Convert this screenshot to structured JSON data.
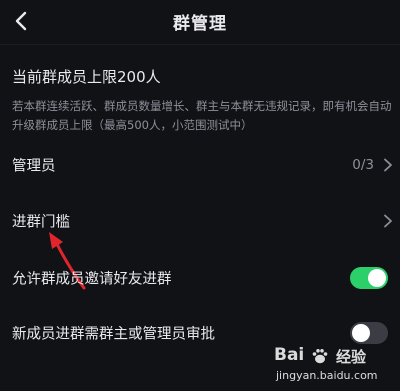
{
  "header": {
    "title": "群管理"
  },
  "member_limit": {
    "title": "当前群成员上限200人",
    "description": "若本群连续活跃、群成员数量增长、群主与本群无违规记录，即有机会自动升级群成员上限（最高500人，小范围测试中）"
  },
  "rows": [
    {
      "label": "管理员",
      "value": "0/3"
    },
    {
      "label": "进群门槛"
    },
    {
      "label": "允许群成员邀请好友进群",
      "toggle": "on"
    },
    {
      "label": "新成员进群需群主或管理员审批",
      "toggle": "off"
    }
  ],
  "watermark": {
    "logo_text": "Bai",
    "logo_suffix": "经验",
    "url": "jingyan.baidu.com"
  },
  "colors": {
    "background": "#111216",
    "toggle_on": "#2bd06a",
    "toggle_off": "#3b3c44",
    "annotation_arrow": "#e0262c"
  },
  "icons": {
    "back": "chevron-left-icon",
    "row_arrow": "chevron-right-icon",
    "annotation": "red-arrow-icon"
  }
}
